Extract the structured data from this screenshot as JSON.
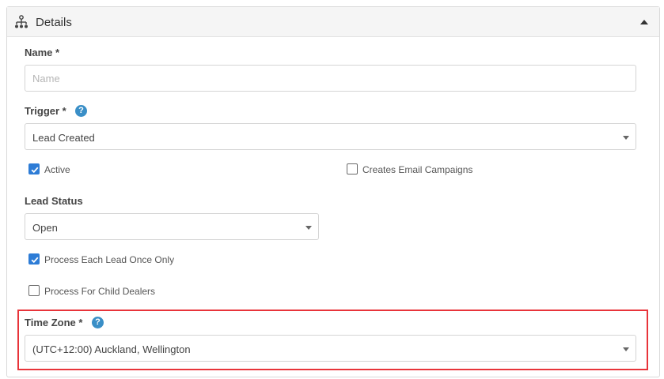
{
  "header": {
    "title": "Details",
    "icon": "sitemap-icon",
    "collapse_icon": "caret-up-icon"
  },
  "name_field": {
    "label": "Name *",
    "placeholder": "Name",
    "value": ""
  },
  "trigger_field": {
    "label": "Trigger *",
    "help_icon": "?",
    "selected": "Lead Created"
  },
  "checkboxes": {
    "active": {
      "label": "Active",
      "checked": true
    },
    "creates_email_campaigns": {
      "label": "Creates Email Campaigns",
      "checked": false
    },
    "process_each_lead_once": {
      "label": "Process Each Lead Once Only",
      "checked": true
    },
    "process_for_child_dealers": {
      "label": "Process For Child Dealers",
      "checked": false
    }
  },
  "lead_status_field": {
    "label": "Lead Status",
    "selected": "Open"
  },
  "time_zone_field": {
    "label": "Time Zone *",
    "help_icon": "?",
    "selected": "(UTC+12:00) Auckland, Wellington"
  },
  "colors": {
    "accent": "#2d7cd6",
    "help": "#3a8fc7",
    "highlight": "#e8343a"
  }
}
